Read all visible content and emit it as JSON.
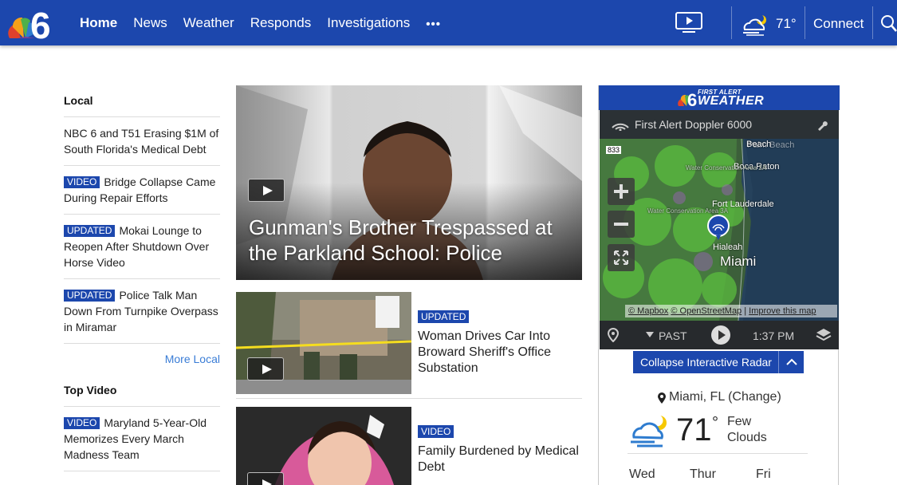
{
  "header": {
    "logo_text": "6",
    "nav": [
      "Home",
      "News",
      "Weather",
      "Responds",
      "Investigations"
    ],
    "more": "•••",
    "temp": "71°",
    "connect": "Connect",
    "icons": [
      "video-tv-icon",
      "partly-cloudy-icon",
      "search-icon"
    ],
    "colors": {
      "brand": "#1c47ad",
      "accent": "#3a7dd6"
    }
  },
  "local": {
    "title": "Local",
    "stories": [
      {
        "tag": "",
        "text": "NBC 6 and T51 Erasing $1M of South Florida's Medical Debt"
      },
      {
        "tag": "VIDEO",
        "text": "Bridge Collapse Came During Repair Efforts"
      },
      {
        "tag": "UPDATED",
        "text": "Mokai Lounge to Reopen After Shutdown Over Horse Video"
      },
      {
        "tag": "UPDATED",
        "text": "Police Talk Man Down From Turnpike Overpass in Miramar"
      }
    ],
    "more": "More Local"
  },
  "top_video": {
    "title": "Top Video",
    "stories": [
      {
        "tag": "VIDEO",
        "text": "Maryland 5-Year-Old Memorizes Every March Madness Team"
      }
    ]
  },
  "hero": {
    "title": "Gunman's Brother Trespassed at the Parkland School: Police"
  },
  "cards": [
    {
      "tag": "UPDATED",
      "title": "Woman Drives Car Into Broward Sheriff's Office Substation"
    },
    {
      "tag": "VIDEO",
      "title": "Family Burdened by Medical Debt"
    }
  ],
  "weather": {
    "header_small": "FIRST ALERT",
    "header_big": "WEATHER",
    "map_title": "First Alert Doppler 6000",
    "map_labels": {
      "palm_beach": "Palm Beach",
      "beach": "Beach",
      "boca": "Boca Raton",
      "wca2a": "Water Conservation Area 2A",
      "wca3a": "Water Conservation Area 3A",
      "ftl": "Fort Lauderdale",
      "hialeah": "Hialeah",
      "miami": "Miami",
      "road": "833"
    },
    "attribution": [
      "© Mapbox",
      "© OpenStreetMap",
      "Improve this map"
    ],
    "past": "PAST",
    "time": "1:37 PM",
    "collapse": "Collapse Interactive Radar",
    "location": "Miami, FL (Change)",
    "temp": "71",
    "deg": "°",
    "condition": "Few Clouds",
    "days": [
      "Wed",
      "Thur",
      "Fri"
    ]
  }
}
